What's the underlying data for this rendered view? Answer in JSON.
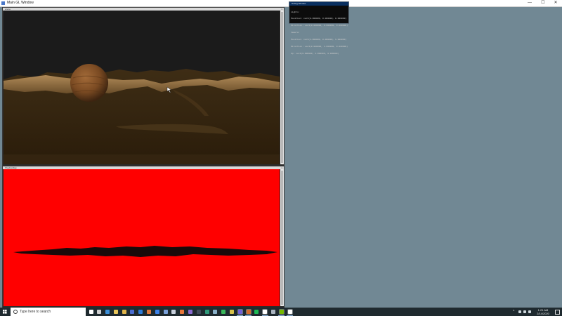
{
  "window": {
    "title": "Main GL Window",
    "min_symbol": "—",
    "max_symbol": "☐",
    "close_symbol": "✕"
  },
  "scene_window": {
    "title": "scene",
    "close_symbol": "x"
  },
  "shadow_window": {
    "title": "ShadowMap",
    "close_symbol": "x"
  },
  "console": {
    "title": "Debug Window",
    "lines": [
      "Lights:",
      "Position: vec3(0.000000, 0.000000, 0.000000)",
      "Direction: vec3(0.000000, 0.000000, 0.000000)",
      "Camera:",
      "Position: vec3(1.000000, 0.000000, 1.000000)",
      "Direction: vec3(0.000000, 1.000000, 0.000000)",
      "Up: vec3(0.000000, 1.000000, 0.000000)"
    ]
  },
  "taskbar": {
    "search_placeholder": "Type here to search",
    "icons": [
      {
        "name": "cortana-icon",
        "color": "#ffffff",
        "active": false
      },
      {
        "name": "task-view-icon",
        "color": "#d0d0d0",
        "active": false
      },
      {
        "name": "edge-icon",
        "color": "#3c8fd8",
        "active": false
      },
      {
        "name": "file-explorer-icon",
        "color": "#e8c55a",
        "active": false
      },
      {
        "name": "chrome-icon",
        "color": "#e0b54a",
        "active": false
      },
      {
        "name": "firefox-dev-icon",
        "color": "#4a6cd0",
        "active": false
      },
      {
        "name": "app-icon",
        "color": "#2d7bd8",
        "active": false
      },
      {
        "name": "flame-icon",
        "color": "#e07a3a",
        "active": false
      },
      {
        "name": "dropbox-icon",
        "color": "#3d82e8",
        "active": false
      },
      {
        "name": "globe-icon",
        "color": "#7aa0d8",
        "active": false
      },
      {
        "name": "steam-icon",
        "color": "#c8d0dc",
        "active": false
      },
      {
        "name": "firefox-icon",
        "color": "#e8763a",
        "active": false
      },
      {
        "name": "media-icon",
        "color": "#8a6ad0",
        "active": false
      },
      {
        "name": "terminal-icon",
        "color": "#404a58",
        "active": false
      },
      {
        "name": "visual-studio-icon",
        "color": "#2f9a7a",
        "active": false
      },
      {
        "name": "remote-icon",
        "color": "#8ab0c8",
        "active": false
      },
      {
        "name": "green-app-icon",
        "color": "#3ab85a",
        "active": false
      },
      {
        "name": "yellow-app-icon",
        "color": "#d8c24a",
        "active": false
      },
      {
        "name": "purple-app-icon",
        "color": "#7060d8",
        "active": true
      },
      {
        "name": "orange-app-icon",
        "color": "#d86a2a",
        "active": true
      },
      {
        "name": "spotify-icon",
        "color": "#1db954",
        "active": false
      },
      {
        "name": "gl-window-icon",
        "color": "#ffffff",
        "active": true
      },
      {
        "name": "steam-client-icon",
        "color": "#aab4c0",
        "active": false
      },
      {
        "name": "nvidia-icon",
        "color": "#76b900",
        "active": true
      },
      {
        "name": "console-icon",
        "color": "#ffffff",
        "active": true
      }
    ],
    "tray_chevron": "^",
    "time": "1:21 AM",
    "date": "2/14/2020"
  },
  "colors": {
    "desktop": "#718894",
    "shadow_map_bg": "#ff0000",
    "terrain": "#5a4120",
    "sky": "#1d1d1d"
  }
}
